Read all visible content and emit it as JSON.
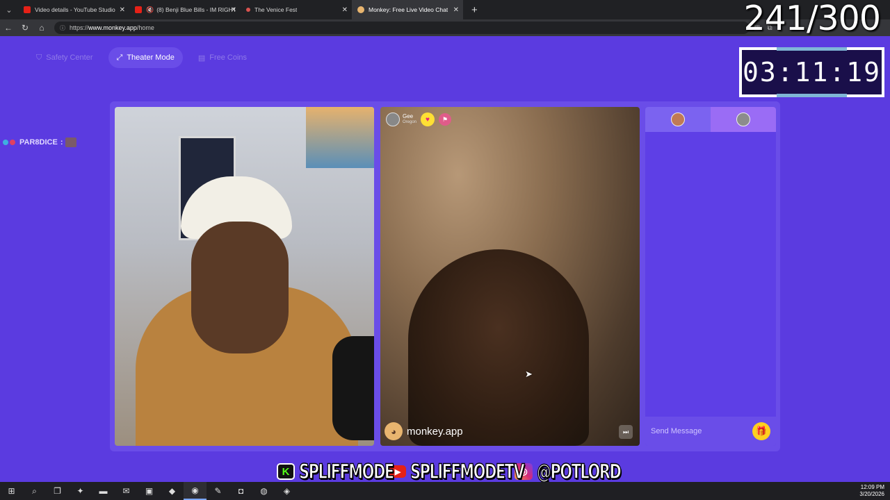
{
  "browser": {
    "tabs": [
      {
        "title": "Video details - YouTube Studio",
        "favicon_color": "#e62117",
        "active": false
      },
      {
        "title": "(8) Benji Blue Bills - IM RIGHT",
        "favicon_color": "#e62117",
        "active": false
      },
      {
        "title": "The Venice Fest",
        "favicon_color": "#d9534f",
        "active": false
      },
      {
        "title": "Monkey: Free Live Video Chat",
        "favicon_color": "#e8b56f",
        "active": true
      }
    ],
    "url_prefix": "https://",
    "url_host": "www.monkey.app",
    "url_path": "/home"
  },
  "overlay": {
    "counter": "241/300",
    "timer": "03:11:19"
  },
  "topnav": {
    "items": [
      {
        "label": "Safety Center",
        "icon": "shield-icon",
        "active": false
      },
      {
        "label": "Theater Mode",
        "icon": "expand-icon",
        "active": true
      },
      {
        "label": "Free Coins",
        "icon": "coins-icon",
        "active": false
      }
    ]
  },
  "stream_chat": {
    "username": "PAR8DICE",
    "separator": ":"
  },
  "remote_user": {
    "name": "Gee",
    "location": "Oregon"
  },
  "video": {
    "watermark": "monkey.app"
  },
  "chat_panel": {
    "placeholder": "Send Message"
  },
  "socials": [
    {
      "icon": "kick-icon",
      "handle": "SPLIFFMODE"
    },
    {
      "icon": "youtube-icon",
      "handle": "SPLIFFMODETV"
    },
    {
      "icon": "instagram-icon",
      "handle": "@POTLORD"
    }
  ],
  "taskbar": {
    "time": "12:09 PM",
    "date": "3/20/2026"
  },
  "colors": {
    "brand": "#5b3be0",
    "accent": "#6a4de8"
  }
}
